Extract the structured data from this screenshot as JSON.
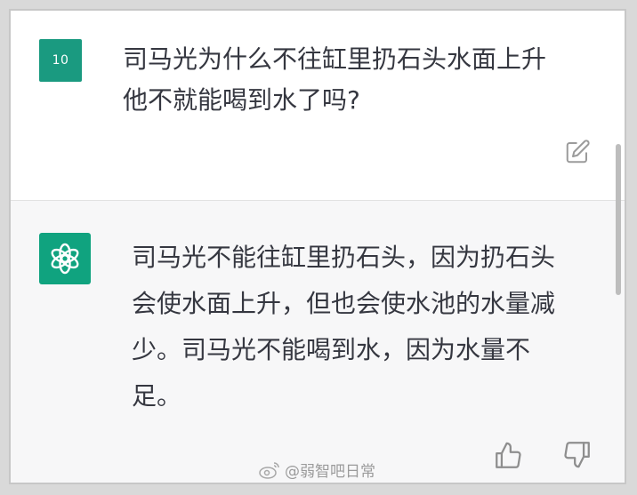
{
  "user": {
    "avatar_initials": "10",
    "message": "司马光为什么不往缸里扔石头水面上升\n他不就能喝到水了吗?"
  },
  "assistant": {
    "message": "司马光不能往缸里扔石头，因为扔石头\n会使水面上升，但也会使水池的水量减\n少。司马光不能喝到水，因为水量不\n足。"
  },
  "icons": {
    "edit": "edit-icon",
    "thumb_up": "thumbs-up-icon",
    "thumb_down": "thumbs-down-icon",
    "assistant_logo": "openai-logo-icon"
  },
  "watermark": {
    "text": "@弱智吧日常"
  },
  "colors": {
    "user_avatar_bg": "#1a9a80",
    "assistant_avatar_bg": "#10a37f",
    "assistant_bg": "#f7f7f8"
  }
}
